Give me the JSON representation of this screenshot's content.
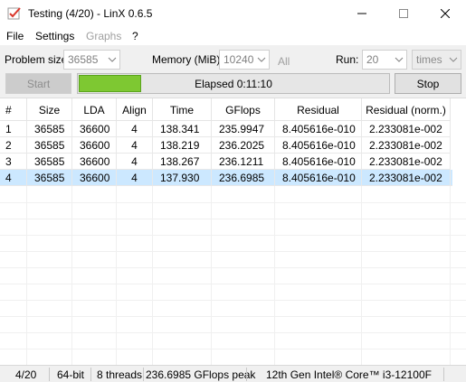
{
  "window": {
    "title": "Testing (4/20) - LinX 0.6.5"
  },
  "menu": [
    "File",
    "Settings",
    "Graphs",
    "?"
  ],
  "settings": {
    "problem_size_label": "Problem size:",
    "problem_size_value": "36585",
    "memory_label": "Memory (MiB):",
    "memory_value": "10240",
    "all_label": "All",
    "run_label": "Run:",
    "run_value": "20",
    "run_unit": "times"
  },
  "actions": {
    "start_label": "Start",
    "stop_label": "Stop",
    "elapsed": "Elapsed 0:11:10",
    "progress_fraction": 0.2
  },
  "table": {
    "columns": [
      "#",
      "Size",
      "LDA",
      "Align",
      "Time",
      "GFlops",
      "Residual",
      "Residual (norm.)"
    ],
    "rows": [
      [
        "1",
        "36585",
        "36600",
        "4",
        "138.341",
        "235.9947",
        "8.405616e-010",
        "2.233081e-002"
      ],
      [
        "2",
        "36585",
        "36600",
        "4",
        "138.219",
        "236.2025",
        "8.405616e-010",
        "2.233081e-002"
      ],
      [
        "3",
        "36585",
        "36600",
        "4",
        "138.267",
        "236.1211",
        "8.405616e-010",
        "2.233081e-002"
      ],
      [
        "4",
        "36585",
        "36600",
        "4",
        "137.930",
        "236.6985",
        "8.405616e-010",
        "2.233081e-002"
      ]
    ],
    "selected_row": 3
  },
  "status": {
    "progress": "4/20",
    "bits": "64-bit",
    "threads": "8 threads",
    "peak": "236.6985 GFlops peak",
    "cpu": "12th Gen Intel® Core™ i3-12100F"
  },
  "colors": {
    "progress_green": "#7ec832",
    "selection": "#cce8ff"
  }
}
